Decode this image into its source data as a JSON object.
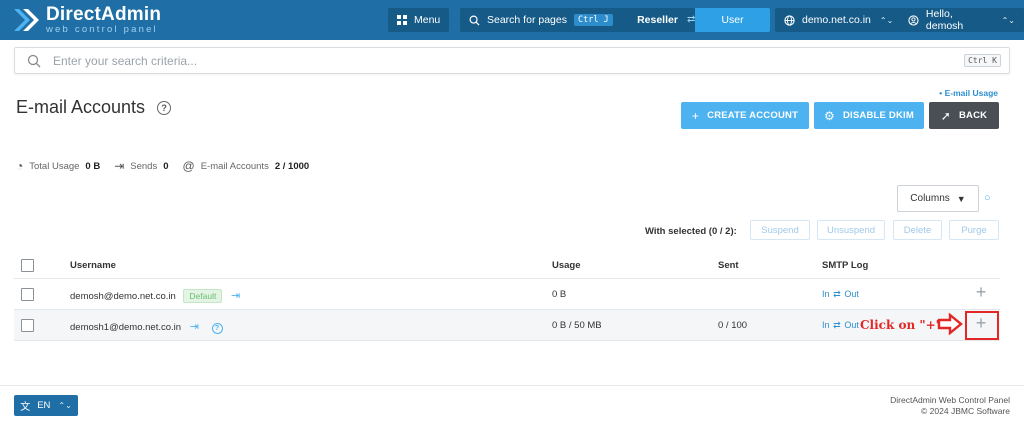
{
  "brand": {
    "title": "DirectAdmin",
    "subtitle": "web control panel",
    "icon": "directadmin-logo-icon",
    "color": "#1f6fa6"
  },
  "topbar": {
    "menu_label": "Menu",
    "search_label": "Search for pages",
    "search_shortcut": "Ctrl J",
    "reseller_label": "Reseller",
    "user_label": "User",
    "domain_label": "demo.net.co.in",
    "greeting_label": "Hello, demosh"
  },
  "search": {
    "placeholder": "Enter your search criteria...",
    "shortcut": "Ctrl K"
  },
  "page": {
    "title": "E-mail Accounts",
    "usage_link": "• E-mail Usage"
  },
  "actions": {
    "create": "CREATE ACCOUNT",
    "dkim": "DISABLE DKIM",
    "back": "BACK"
  },
  "stats": {
    "total_usage_label": "Total Usage",
    "total_usage_value": "0 B",
    "sends_label": "Sends",
    "sends_value": "0",
    "accounts_label": "E-mail Accounts",
    "accounts_value": "2 / 1000"
  },
  "toolbar": {
    "columns_label": "Columns",
    "with_selected": "With selected (0 / 2):",
    "suspend": "Suspend",
    "unsuspend": "Unsuspend",
    "delete": "Delete",
    "purge": "Purge"
  },
  "table": {
    "headers": {
      "username": "Username",
      "usage": "Usage",
      "sent": "Sent",
      "smtp_log": "SMTP Log"
    },
    "rows": [
      {
        "username": "demosh@demo.net.co.in",
        "badge": "Default",
        "usage": "0 B",
        "sent": "",
        "smtp_in": "In",
        "smtp_sep": "⇄",
        "smtp_out": "Out"
      },
      {
        "username": "demosh1@demo.net.co.in",
        "badge": "",
        "usage": "0 B / 50 MB",
        "sent": "0 / 100",
        "smtp_in": "In",
        "smtp_sep": "⇄",
        "smtp_out": "Out"
      }
    ]
  },
  "annotation": {
    "text": "Click on \"+\"",
    "color": "#e32626"
  },
  "footer": {
    "lang": "EN",
    "line1": "DirectAdmin Web Control Panel",
    "line2": "© 2024 JBMC Software"
  }
}
